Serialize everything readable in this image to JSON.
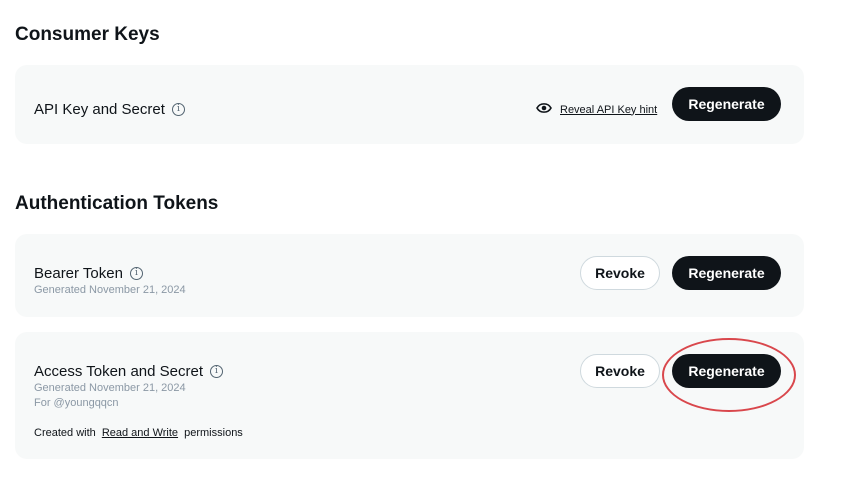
{
  "consumer_keys": {
    "title": "Consumer Keys",
    "api_key": {
      "label": "API Key and Secret",
      "info_icon": "info-icon",
      "reveal_hint_label": "Reveal API Key hint",
      "reveal_icon": "eye-icon",
      "regenerate_label": "Regenerate"
    }
  },
  "auth_tokens": {
    "title": "Authentication Tokens",
    "bearer": {
      "label": "Bearer Token",
      "info_icon": "info-icon",
      "generated": "Generated November 21, 2024",
      "revoke_label": "Revoke",
      "regenerate_label": "Regenerate"
    },
    "access": {
      "label": "Access Token and Secret",
      "info_icon": "info-icon",
      "generated": "Generated November 21, 2024",
      "for_user": "For @youngqqcn",
      "created_prefix": "Created with",
      "permission_link": "Read and Write",
      "created_suffix": "permissions",
      "revoke_label": "Revoke",
      "regenerate_label": "Regenerate"
    }
  },
  "colors": {
    "card_bg": "#f7f9f9",
    "button_dark": "#0f1419",
    "annotation": "#d9474c"
  }
}
